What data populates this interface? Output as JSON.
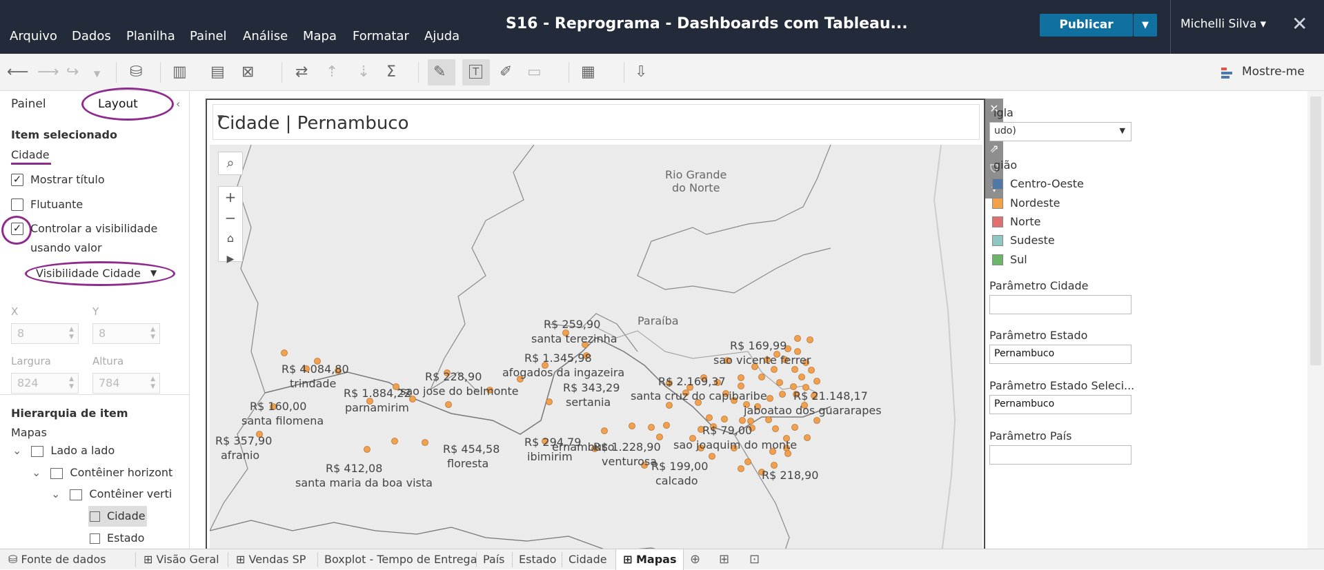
{
  "menu": [
    "Arquivo",
    "Dados",
    "Planilha",
    "Painel",
    "Análise",
    "Mapa",
    "Formatar",
    "Ajuda"
  ],
  "window_title": "S16 - Reprograma - Dashboards com Tableau...",
  "publish_label": "Publicar",
  "user_name": "Michelli Silva ▾",
  "show_me_label": "Mostre-me",
  "left_panel": {
    "tab_painel": "Painel",
    "tab_layout": "Layout",
    "selected_item_header": "Item selecionado",
    "selected_item_name": "Cidade",
    "show_title": "Mostrar título",
    "floating": "Flutuante",
    "control_visibility_1": "Controlar a visibilidade",
    "control_visibility_2": "usando valor",
    "visibility_dropdown": "Visibilidade Cidade",
    "x_label": "X",
    "x_value": "8",
    "y_label": "Y",
    "y_value": "8",
    "width_label": "Largura",
    "width_value": "824",
    "height_label": "Altura",
    "height_value": "784",
    "hierarchy_header": "Hierarquia de item",
    "hierarchy_root": "Mapas",
    "hierarchy": [
      "Lado a lado",
      "Contêiner horizont",
      "Contêiner verti",
      "Cidade",
      "Estado"
    ]
  },
  "sheet": {
    "title": "Cidade | Pernambuco",
    "places": [
      "Rio Grande\ndo Norte",
      "Paraíba"
    ],
    "labels": [
      {
        "price": "R$ 4.084,80",
        "city": "trindade"
      },
      {
        "price": "R$ 160,00",
        "city": "santa filomena"
      },
      {
        "price": "R$ 357,90",
        "city": "afranio"
      },
      {
        "price": "R$ 1.884,22",
        "city": "parnamirim"
      },
      {
        "price": "R$ 228,90",
        "city": "sao jose do belmonte"
      },
      {
        "price": "R$ 412,08",
        "city": "santa maria da boa vista"
      },
      {
        "price": "R$ 454,58",
        "city": "floresta"
      },
      {
        "price": "R$ 259,90",
        "city": "santa terezinha"
      },
      {
        "price": "R$ 1.345,98",
        "city": "afogados da ingazeira"
      },
      {
        "price": "R$ 343,29",
        "city": "sertania"
      },
      {
        "price": "R$ 294,79",
        "city": "ibimirim"
      },
      {
        "price": "R$ 1.228,90",
        "city": "venturosa"
      },
      {
        "price": "R$ 199,00",
        "city": "calcado"
      },
      {
        "price": "R$ 2.169,37",
        "city": "santa cruz do capibaribe"
      },
      {
        "price": "R$ 79,00",
        "city": "sao joaquim do monte"
      },
      {
        "price": "R$ 169,99",
        "city": "sao vicente ferrer"
      },
      {
        "price": "R$ 21.148,17",
        "city": "jaboatao dos guararapes"
      },
      {
        "price": "R$ 218,90",
        "city": ""
      }
    ],
    "partial_label": "ernambuco"
  },
  "right_panel": {
    "sigla_label": "igla",
    "sigla_value": "udo)",
    "regiao_label": "gião",
    "regions": [
      {
        "name": "Centro-Oeste",
        "color": "#4e79a7"
      },
      {
        "name": "Nordeste",
        "color": "#f2a04a"
      },
      {
        "name": "Norte",
        "color": "#e26f6f"
      },
      {
        "name": "Sudeste",
        "color": "#8fc7c3"
      },
      {
        "name": "Sul",
        "color": "#6ab56a"
      }
    ],
    "param_cidade_label": "Parâmetro Cidade",
    "param_cidade_value": "",
    "param_estado_label": "Parâmetro Estado",
    "param_estado_value": "Pernambuco",
    "param_estado_sel_label": "Parâmetro Estado Seleci...",
    "param_estado_sel_value": "Pernambuco",
    "param_pais_label": "Parâmetro País",
    "param_pais_value": ""
  },
  "tabs": {
    "datasource": "Fonte de dados",
    "items": [
      "Visão Geral",
      "Vendas SP",
      "Boxplot - Tempo de Entrega",
      "País",
      "Estado",
      "Cidade",
      "Mapas"
    ],
    "active": "Mapas"
  },
  "colors": {
    "topbar": "#232b3b",
    "publish": "#1070a0",
    "annotation": "#8e2c8e",
    "marker": "#f0a04e"
  }
}
